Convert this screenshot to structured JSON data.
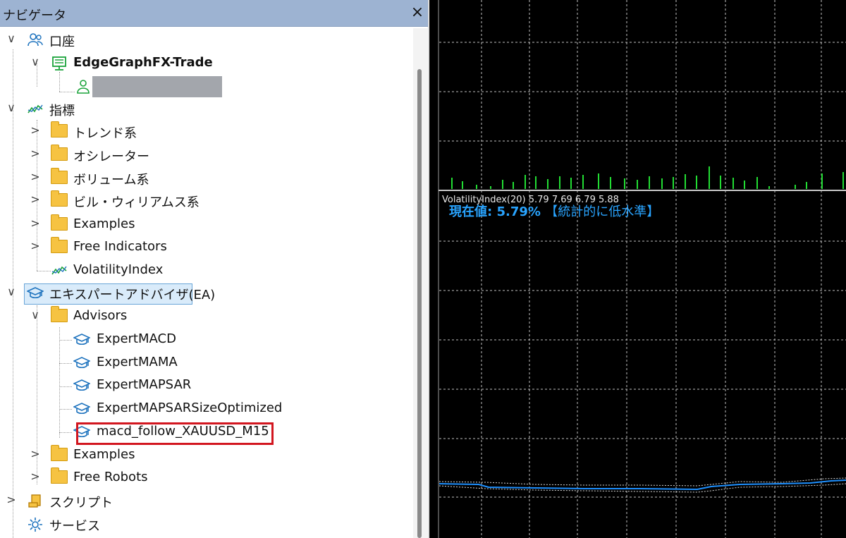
{
  "navigator": {
    "title": "ナビゲータ",
    "close_icon": "×"
  },
  "tree": {
    "account_root": "口座",
    "account_name": "EdgeGraphFX-Trade",
    "indicators_root": "指標",
    "ind_folders": [
      "トレンド系",
      "オシレーター",
      "ボリューム系",
      "ビル・ウィリアムス系",
      "Examples",
      "Free Indicators"
    ],
    "ind_item": "VolatilityIndex",
    "ea_root": "エキスパートアドバイザ(EA)",
    "advisors_folder": "Advisors",
    "advisors": [
      "ExpertMACD",
      "ExpertMAMA",
      "ExpertMAPSAR",
      "ExpertMAPSARSizeOptimized",
      "macd_follow_XAUUSD_M15"
    ],
    "ea_folders": [
      "Examples",
      "Free Robots"
    ],
    "scripts": "スクリプト",
    "services": "サービス"
  },
  "chart": {
    "indicator_label": "VolatilityIndex(20) 5.79 7.69 6.79 5.88",
    "current_value_text": "現在値: 5.79%",
    "level_text": "【統計的に低水準】",
    "colors": {
      "volume": "#22dd33",
      "line": "#1e90ff",
      "grid": "#bfbfbf",
      "text": "#29a4ff"
    }
  }
}
